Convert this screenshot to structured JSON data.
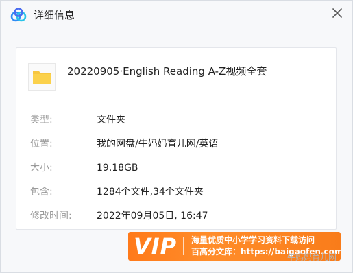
{
  "window": {
    "title": "详细信息",
    "icon": "baidu-netdisk-icon",
    "close_icon": "close-icon"
  },
  "file": {
    "icon": "folder-icon",
    "name": "20220905·English Reading A-Z视频全套"
  },
  "details": [
    {
      "label": "类型:",
      "value": "文件夹"
    },
    {
      "label": "位置:",
      "value": "我的网盘/牛妈妈育儿网/英语"
    },
    {
      "label": "大小:",
      "value": "19.18GB"
    },
    {
      "label": "包含:",
      "value": "1284个文件,34个文件夹"
    },
    {
      "label": "修改时间:",
      "value": "2022年09月05日, 16:47"
    }
  ],
  "banner": {
    "badge": "VIP",
    "line1": "海量优质中小学学习资料下载访问",
    "line2": "百高分文库：https://baigaofen.com"
  },
  "watermark": "牛妈妈育儿网",
  "colors": {
    "banner_orange": "#ff7a1a",
    "folder_yellow": "#f7c640",
    "label_gray": "#9a9a9a"
  }
}
